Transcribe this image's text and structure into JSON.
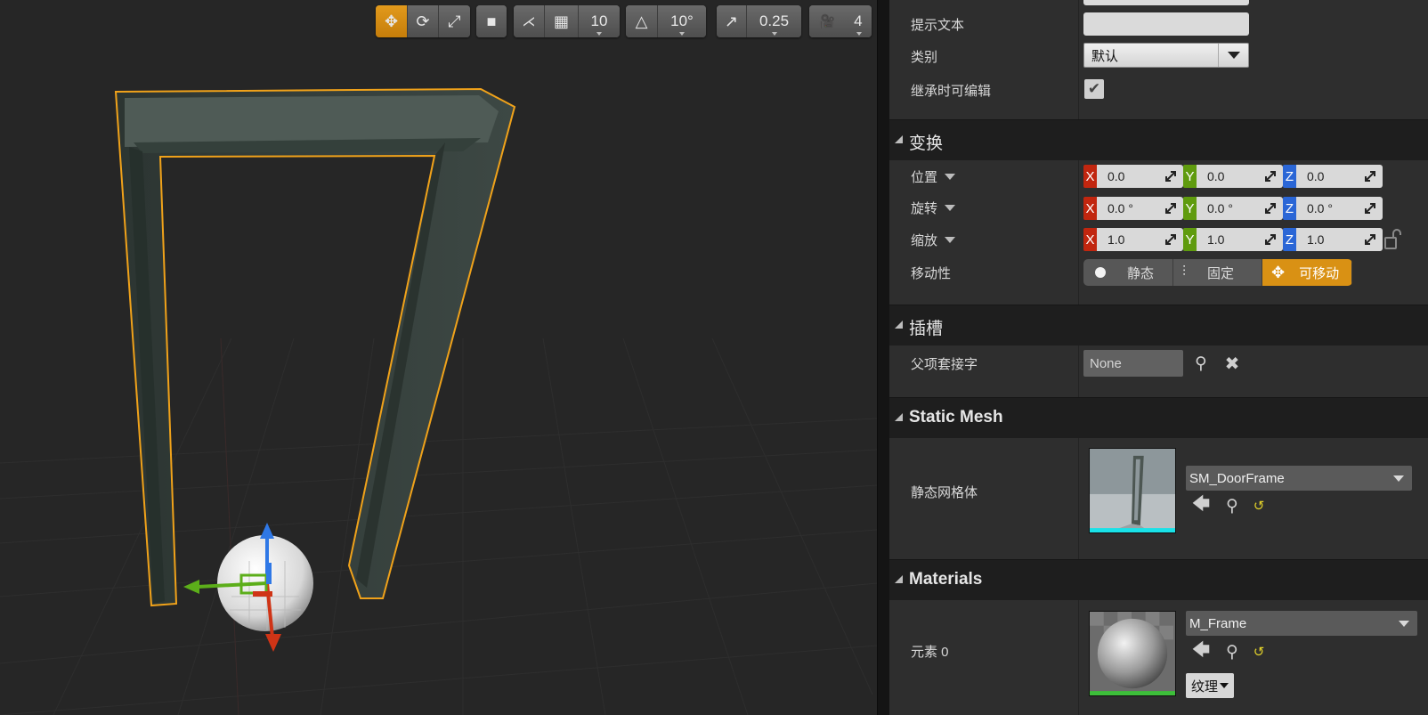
{
  "toolbar": {
    "grid_snap_value": "10",
    "rotation_snap_value": "10°",
    "scale_snap_value": "0.25",
    "camera_speed_value": "4"
  },
  "details": {
    "tooltip_label": "提示文本",
    "category_label": "类别",
    "category_value": "默认",
    "editable_when_inherited_label": "继承时可编辑",
    "editable_when_inherited_checked": true,
    "transform": {
      "section_title": "变换",
      "location_label": "位置",
      "rotation_label": "旋转",
      "scale_label": "缩放",
      "mobility_label": "移动性",
      "location": {
        "x": "0.0",
        "y": "0.0",
        "z": "0.0"
      },
      "rotation": {
        "x": "0.0 °",
        "y": "0.0 °",
        "z": "0.0 °"
      },
      "scale": {
        "x": "1.0",
        "y": "1.0",
        "z": "1.0"
      },
      "axis_labels": {
        "x": "X",
        "y": "Y",
        "z": "Z"
      },
      "mobility_options": [
        "静态",
        "固定",
        "可移动"
      ],
      "mobility_selected": "可移动"
    },
    "sockets": {
      "section_title": "插槽",
      "parent_socket_label": "父项套接字",
      "parent_socket_value": "None"
    },
    "static_mesh": {
      "section_title": "Static Mesh",
      "mesh_label": "静态网格体",
      "mesh_value": "SM_DoorFrame"
    },
    "materials": {
      "section_title": "Materials",
      "element_label": "元素 0",
      "material_value": "M_Frame",
      "texture_dropdown": "纹理"
    }
  },
  "colors": {
    "accent_orange": "#d99114",
    "axis_x": "#c1260f",
    "axis_y": "#5f9b0e",
    "axis_z": "#2a66d6",
    "selection_outline": "#f0a21a"
  }
}
